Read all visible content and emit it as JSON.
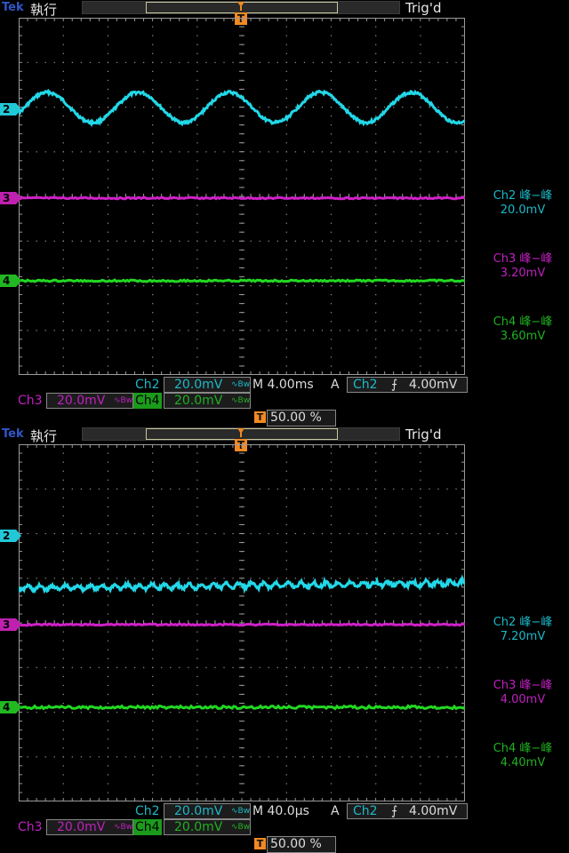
{
  "screens": [
    {
      "header": {
        "brand": "Tek",
        "run_state": "執行",
        "trigger_state": "Trig'd",
        "trigger_marker": "T"
      },
      "channel_markers": {
        "ch2": "2",
        "ch3": "3",
        "ch4": "4"
      },
      "measurements": [
        {
          "label": "Ch2 峰−峰",
          "value": "20.0mV"
        },
        {
          "label": "Ch3 峰−峰",
          "value": "3.20mV"
        },
        {
          "label": "Ch4 峰−峰",
          "value": "3.60mV"
        }
      ],
      "status": {
        "ch2_label": "Ch2",
        "ch2_scale": "20.0mV",
        "ch3_label": "Ch3",
        "ch3_scale": "20.0mV",
        "ch4_label": "Ch4",
        "ch4_scale": "20.0mV",
        "bw_symbol": "∿Bw",
        "timebase": "M 4.00ms",
        "trig_mode": "A",
        "trig_source": "Ch2",
        "trig_slope": "⨍",
        "trig_level": "4.00mV",
        "trig_position": "50.00 %"
      },
      "traces": {
        "ch2": "sine",
        "ch3": "flat",
        "ch4": "flat"
      }
    },
    {
      "header": {
        "brand": "Tek",
        "run_state": "執行",
        "trigger_state": "Trig'd",
        "trigger_marker": "T"
      },
      "channel_markers": {
        "ch2": "2",
        "ch3": "3",
        "ch4": "4"
      },
      "measurements": [
        {
          "label": "Ch2 峰−峰",
          "value": "7.20mV"
        },
        {
          "label": "Ch3 峰−峰",
          "value": "4.00mV"
        },
        {
          "label": "Ch4 峰−峰",
          "value": "4.40mV"
        }
      ],
      "status": {
        "ch2_label": "Ch2",
        "ch2_scale": "20.0mV",
        "ch3_label": "Ch3",
        "ch3_scale": "20.0mV",
        "ch4_label": "Ch4",
        "ch4_scale": "20.0mV",
        "bw_symbol": "∿Bw",
        "timebase": "M 40.0µs",
        "trig_mode": "A",
        "trig_source": "Ch2",
        "trig_slope": "⨍",
        "trig_level": "4.00mV",
        "trig_position": "50.00 %"
      },
      "traces": {
        "ch2": "noisy-rising",
        "ch3": "flat",
        "ch4": "flat"
      }
    }
  ],
  "colors": {
    "ch2": "#22d8e8",
    "ch3": "#d020c8",
    "ch4": "#22d822",
    "grid": "#9a9a9a",
    "trigger": "#f28a22"
  }
}
